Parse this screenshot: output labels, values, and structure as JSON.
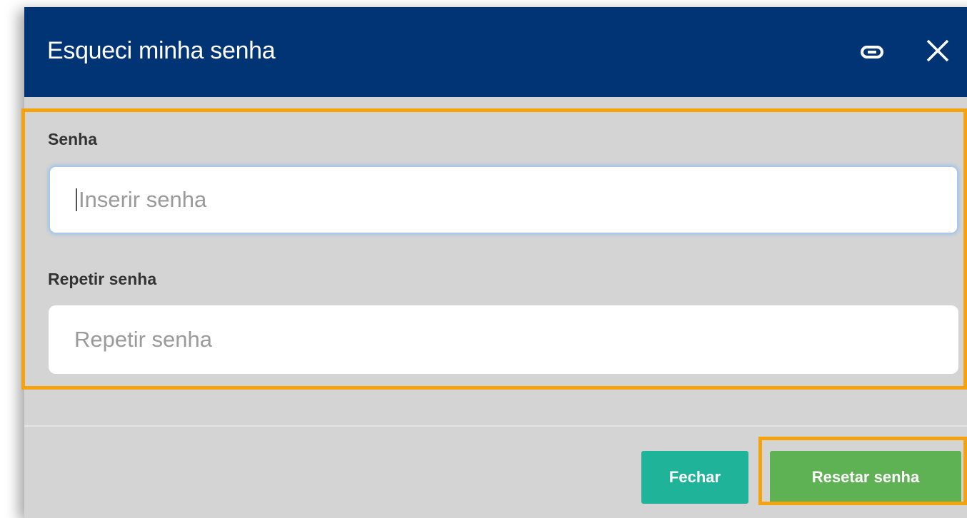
{
  "modal": {
    "title": "Esqueci minha senha",
    "header_color": "#013475",
    "header_icons": [
      "link-icon",
      "close-icon"
    ]
  },
  "form": {
    "password": {
      "label": "Senha",
      "placeholder": "Inserir senha",
      "value": ""
    },
    "repeat_password": {
      "label": "Repetir senha",
      "placeholder": "Repetir senha",
      "value": ""
    }
  },
  "footer": {
    "close_label": "Fechar",
    "reset_label": "Resetar senha",
    "close_color": "#1fb39a",
    "reset_color": "#5fb254"
  },
  "highlight_color": "#f5a20f"
}
